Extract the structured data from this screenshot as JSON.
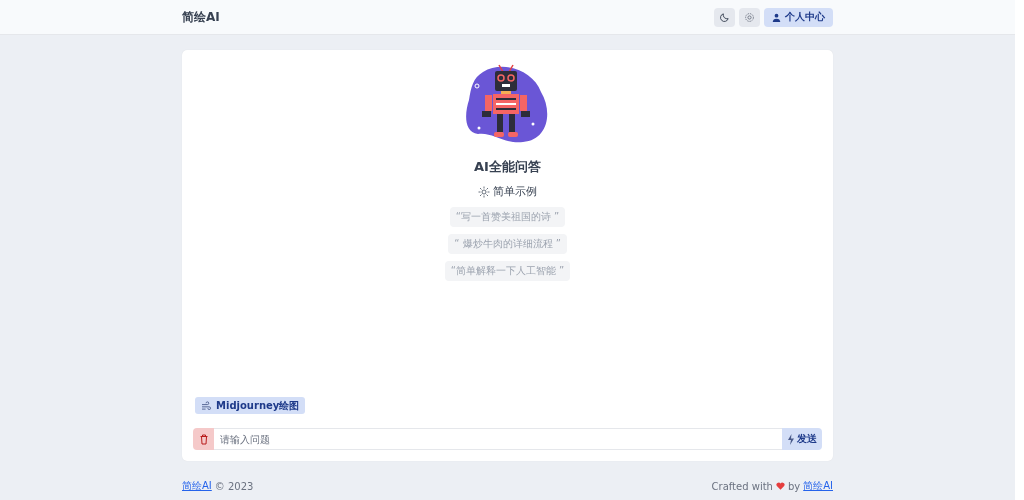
{
  "header": {
    "title": "简绘AI",
    "profile_button": "个人中心"
  },
  "hero": {
    "title": "AI全能问答",
    "examples_heading": "简单示例",
    "examples": [
      "“写一首赞美祖国的诗 ”",
      "“ 爆炒牛肉的详细流程 ”",
      "“简单解释一下人工智能 ”"
    ]
  },
  "mode_button": "Midjourney绘图",
  "input": {
    "placeholder": "请输入问题"
  },
  "send_button": "发送",
  "footer": {
    "brand": "简绘AI",
    "copyright": "© 2023",
    "crafted": "Crafted with",
    "by": "by",
    "author": "简绘AI"
  }
}
